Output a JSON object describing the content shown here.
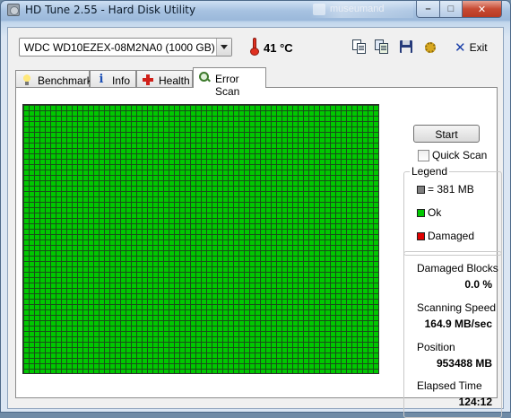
{
  "window": {
    "title": "HD Tune 2.55 - Hard Disk Utility",
    "background_title": "museumand"
  },
  "titlebar_buttons": {
    "minimize": "–",
    "maximize": "□",
    "close": "✕"
  },
  "toolbar": {
    "drive": "WDC WD10EZEX-08M2NA0 (1000 GB)",
    "temperature": "41 °C",
    "exit_label": "Exit",
    "icons": [
      "copy-text-icon",
      "copy-screenshot-icon",
      "save-icon",
      "options-icon",
      "exit-icon"
    ]
  },
  "tabs": [
    {
      "label": "Benchmark",
      "icon": "bulb-icon",
      "active": false
    },
    {
      "label": "Info",
      "icon": "info-icon",
      "active": false
    },
    {
      "label": "Health",
      "icon": "health-cross-icon",
      "active": false
    },
    {
      "label": "Error Scan",
      "icon": "magnifier-icon",
      "active": true
    }
  ],
  "error_scan": {
    "start_label": "Start",
    "quick_scan_label": "Quick Scan",
    "quick_scan_checked": false,
    "grid_color": "#00c800",
    "legend": {
      "title": "Legend",
      "block_size": "= 381 MB",
      "ok": "Ok",
      "damaged": "Damaged",
      "colors": {
        "block": "#808080",
        "ok": "#00c800",
        "damaged": "#e00000"
      }
    },
    "stats": {
      "damaged_blocks_label": "Damaged Blocks",
      "damaged_blocks_value": "0.0 %",
      "scanning_speed_label": "Scanning Speed",
      "scanning_speed_value": "164.9 MB/sec",
      "position_label": "Position",
      "position_value": "953488 MB",
      "elapsed_label": "Elapsed Time",
      "elapsed_value": "124:12"
    }
  }
}
